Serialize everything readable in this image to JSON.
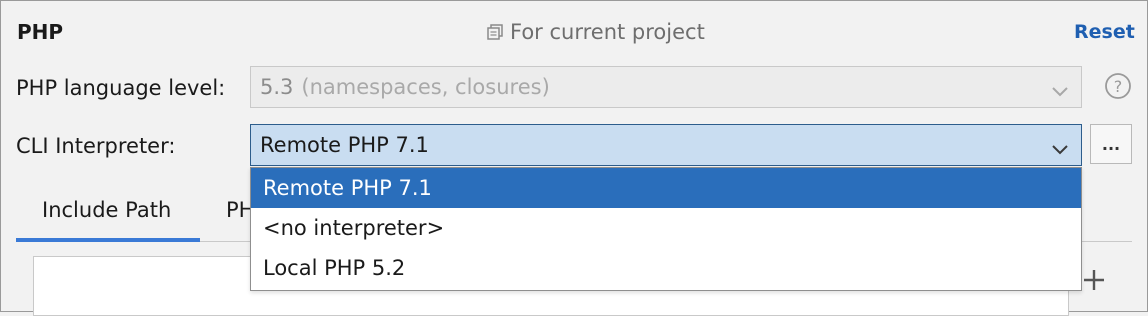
{
  "section": {
    "title": "PHP",
    "scope_label": "For current project",
    "reset_label": "Reset"
  },
  "language_level": {
    "label": "PHP language level:",
    "value": "5.3",
    "description": "(namespaces, closures)",
    "enabled": false
  },
  "cli_interpreter": {
    "label": "CLI Interpreter:",
    "selected": "Remote PHP 7.1",
    "browse_label": "...",
    "dropdown_open": true,
    "options": [
      {
        "label": "Remote PHP 7.1",
        "selected": true
      },
      {
        "label": "<no interpreter>",
        "selected": false
      },
      {
        "label": "Local PHP 5.2",
        "selected": false
      }
    ]
  },
  "tabs": [
    {
      "label": "Include Path",
      "active": true
    },
    {
      "label": "PH",
      "active": false
    }
  ],
  "icons": {
    "scope": "copy-icon",
    "help": "question-circle-icon",
    "dropdown": "chevron-down-icon",
    "add": "plus-icon"
  },
  "colors": {
    "accent": "#1f5fb1",
    "selection": "#2a6ebb",
    "combo_focus_bg": "#c9ddf1",
    "tab_underline": "#3a7ad6"
  }
}
